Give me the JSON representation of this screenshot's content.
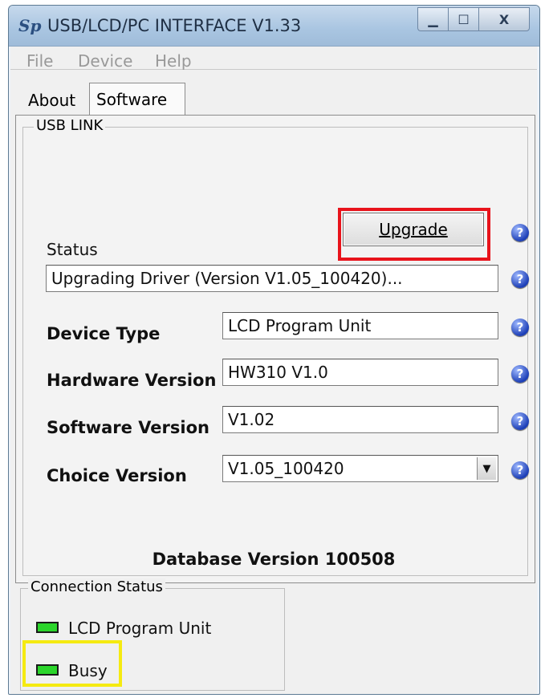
{
  "window": {
    "title": "USB/LCD/PC INTERFACE V1.33",
    "app_icon_text": "Sp",
    "controls": {
      "minimize": "▁",
      "maximize": "☐",
      "close": "X"
    }
  },
  "menubar": {
    "items": [
      "File",
      "Device",
      "Help"
    ]
  },
  "tabs": [
    {
      "label": "About"
    },
    {
      "label": "Software",
      "selected": true
    }
  ],
  "usb_link": {
    "group_label": "USB LINK",
    "upgrade_button": "Upgrade",
    "status_label": "Status",
    "status_value": "Upgrading Driver (Version V1.05_100420)...",
    "fields": [
      {
        "label": "Device Type",
        "value": "LCD Program Unit"
      },
      {
        "label": "Hardware Version",
        "value": "HW310 V1.0"
      },
      {
        "label": "Software Version",
        "value": "V1.02"
      },
      {
        "label": "Choice Version",
        "value": "V1.05_100420"
      }
    ],
    "database_version": "Database Version 100508",
    "help_glyph": "?"
  },
  "connection_status": {
    "group_label": "Connection Status",
    "items": [
      {
        "label": "LCD Program Unit"
      },
      {
        "label": "Busy"
      }
    ]
  },
  "colors": {
    "highlight_red": "#e8131b",
    "highlight_yellow": "#f5ea11",
    "led_green": "#2bd52b",
    "help_icon_blue": "#1d3fb7"
  }
}
